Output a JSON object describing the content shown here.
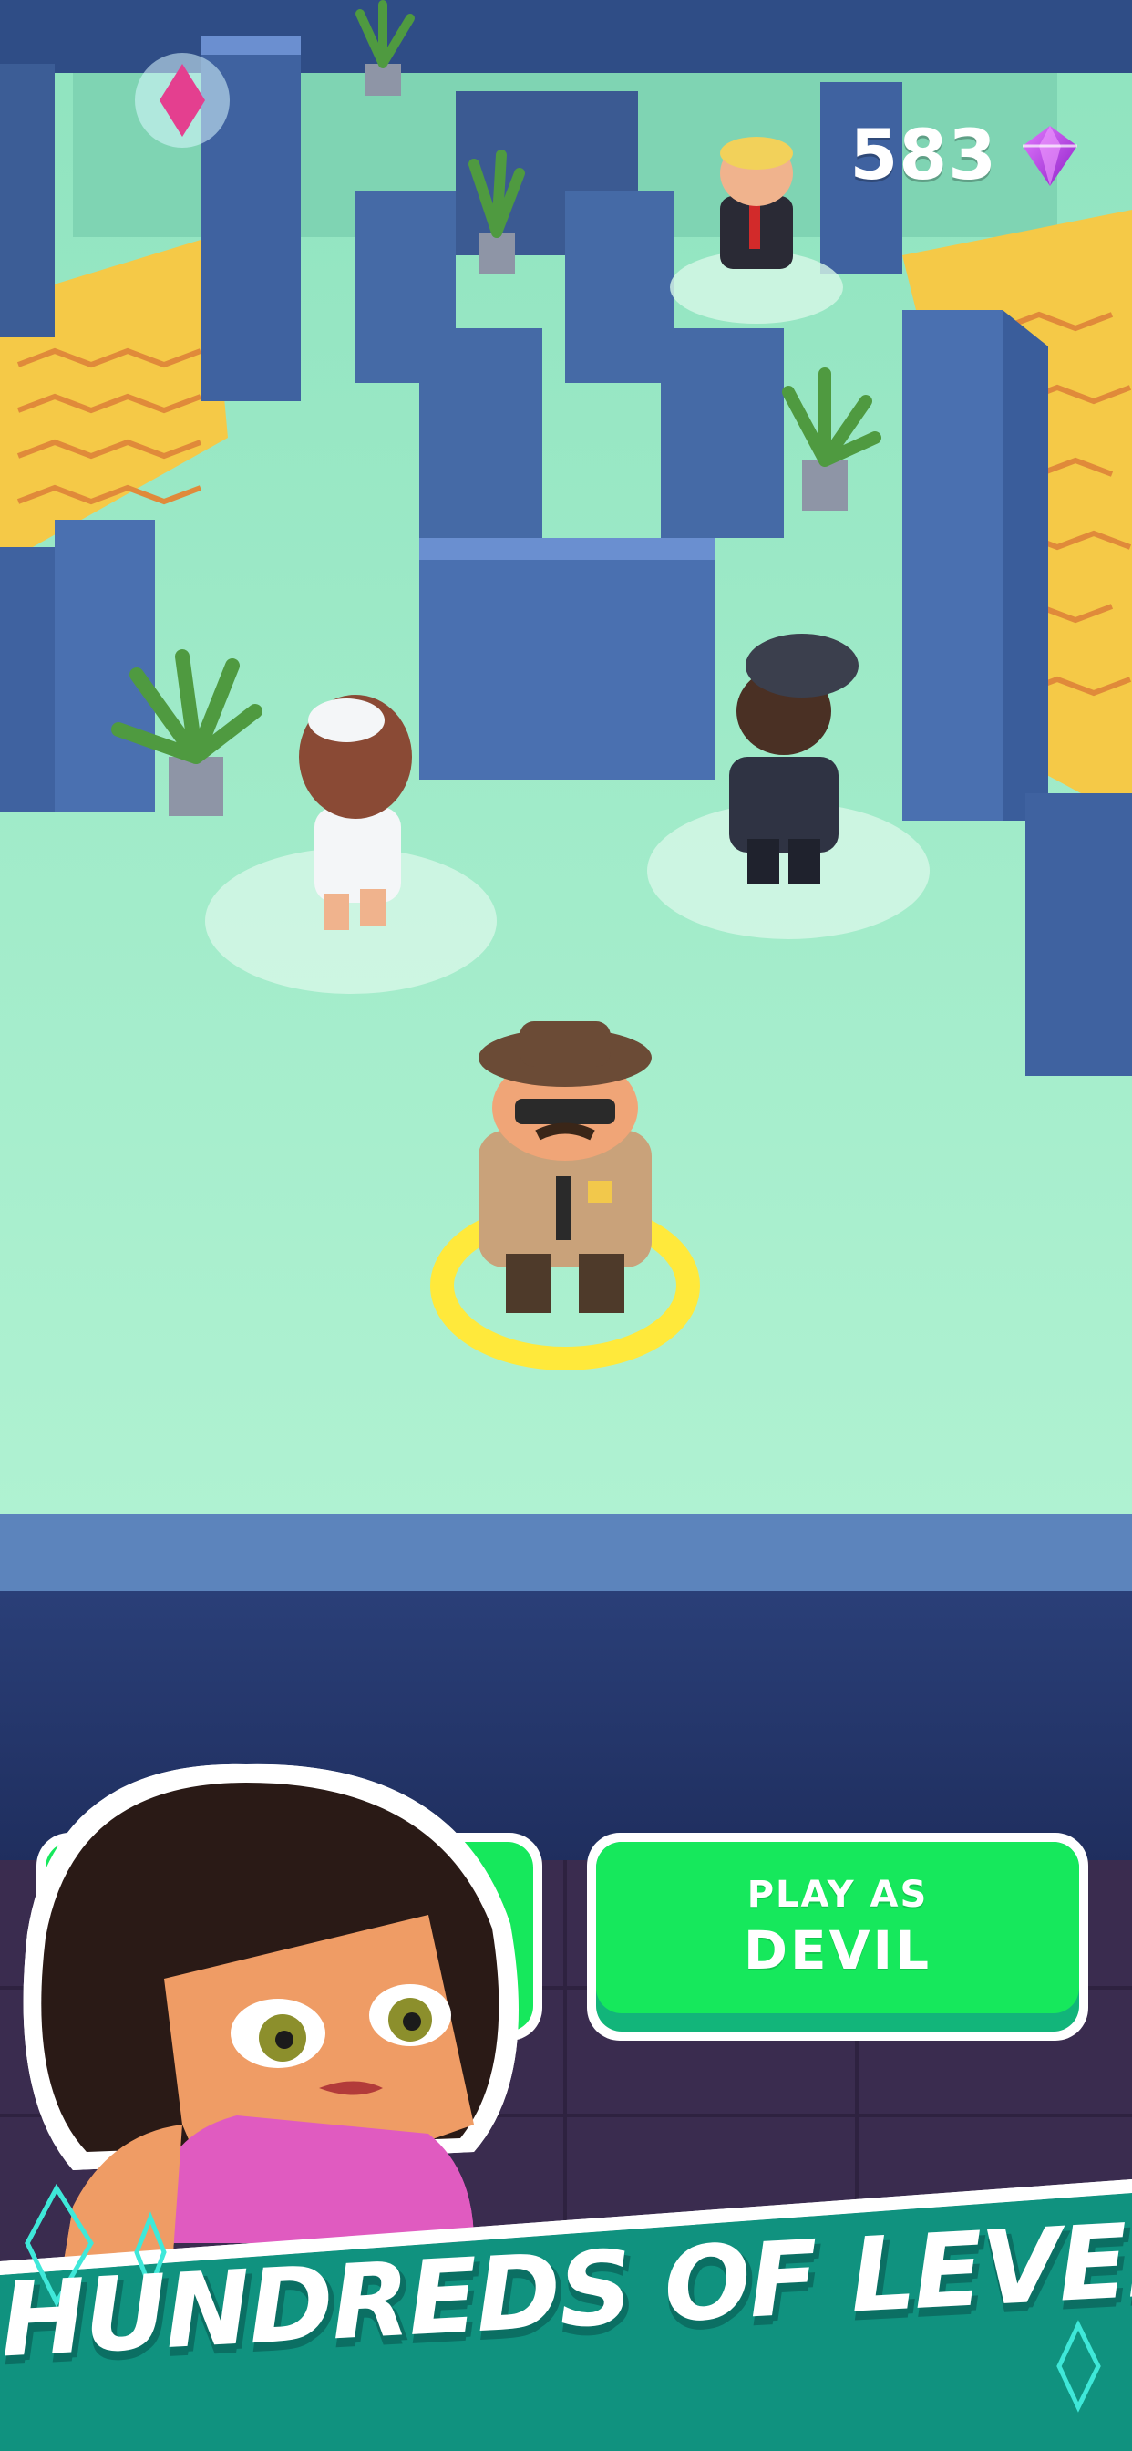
{
  "hud": {
    "gem_count": "583",
    "gem_icon": "gem-icon",
    "gem_color": "#b53be0"
  },
  "buttons": {
    "play_as_line1": "PLAY AS",
    "play_as_line2": "DEVIL",
    "button_color": "#16e85c"
  },
  "banner": {
    "title": "HUNDREDS OF LEVELS!",
    "color": "#10927f"
  },
  "characters": [
    {
      "name": "sheriff",
      "selected": true
    },
    {
      "name": "police-officer"
    },
    {
      "name": "nurse"
    },
    {
      "name": "businessman"
    },
    {
      "name": "woman-portrait"
    }
  ]
}
